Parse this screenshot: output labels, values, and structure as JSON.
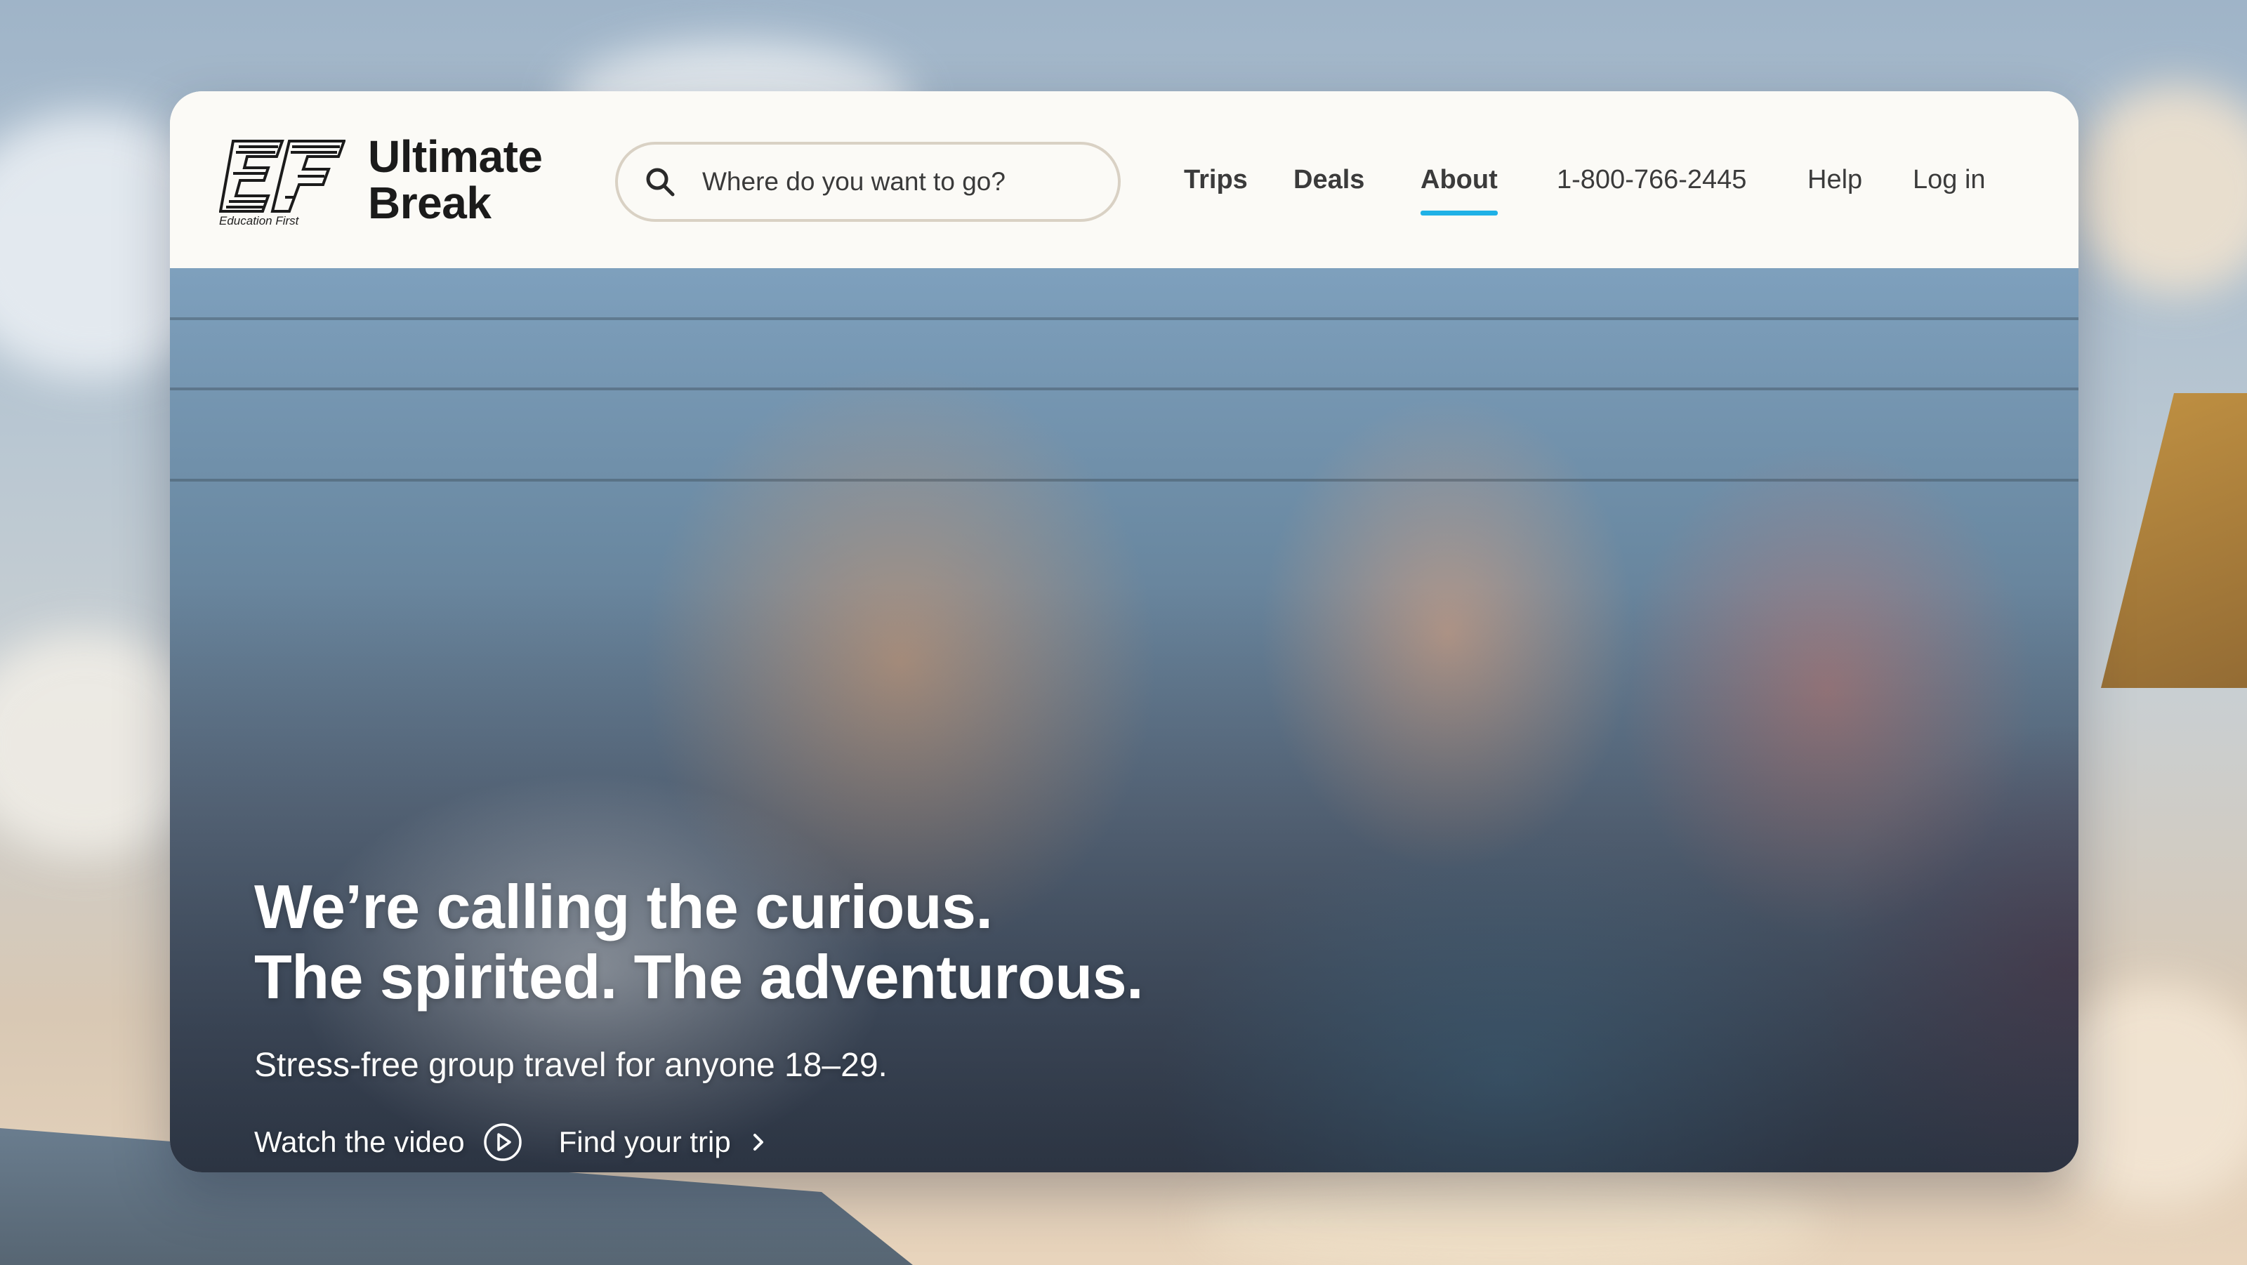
{
  "brand": {
    "logo_line1": "Ultimate",
    "logo_line2": "Break",
    "logo_caption": "Education First",
    "logo_icon": "ef-logo-icon"
  },
  "search": {
    "placeholder": "Where do you want to go?",
    "icon": "search-icon"
  },
  "nav": {
    "items": [
      {
        "label": "Trips",
        "bold": true
      },
      {
        "label": "Deals",
        "bold": true
      },
      {
        "label": "About",
        "bold": true,
        "active": true
      },
      {
        "label": "1-800-766-2445",
        "bold": false
      },
      {
        "label": "Help",
        "bold": false
      },
      {
        "label": "Log in",
        "bold": false
      }
    ]
  },
  "hero": {
    "headline_line1": "We’re calling the curious.",
    "headline_line2": "The spirited. The adventurous.",
    "subheadline": "Stress-free group travel for anyone 18–29.",
    "watch_label": "Watch the video",
    "watch_icon": "play-circle-icon",
    "find_label": "Find your trip",
    "find_icon": "chevron-right-icon"
  },
  "colors": {
    "accent": "#1fb1e6",
    "header_bg": "#fbfaf6",
    "text_dark": "#1b1b1b"
  }
}
